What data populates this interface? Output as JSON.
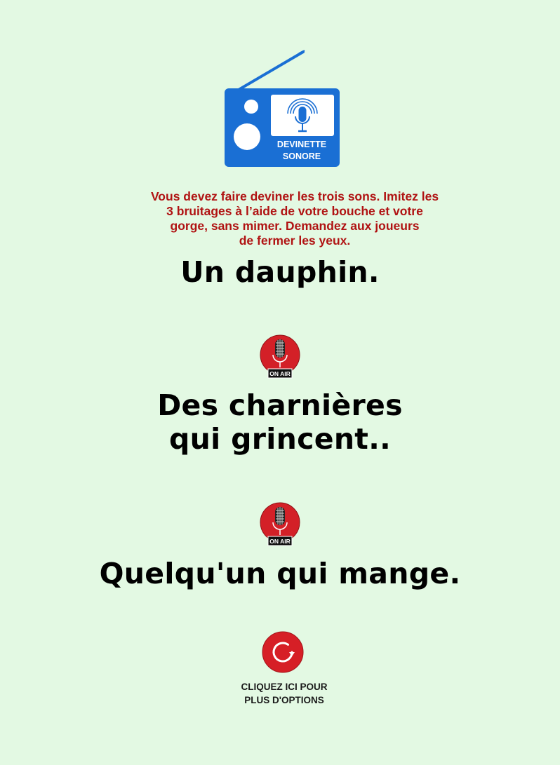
{
  "logo": {
    "icon": "radio-icon",
    "line1": "DEVINETTE",
    "line2": "SONORE",
    "colors": {
      "body": "#1a6fd4",
      "screen": "#ffffff",
      "label": "#ffffff"
    }
  },
  "instructions": {
    "lines": [
      "Vous devez faire deviner les trois sons. Imitez les",
      "3 bruitages à l’aide de votre bouche et votre",
      "gorge, sans mimer. Demandez aux joueurs",
      "de fermer les yeux."
    ],
    "color": "#b01313"
  },
  "sounds": [
    {
      "lines": [
        "Un dauphin."
      ]
    },
    {
      "lines": [
        "Des charnières",
        "qui grincent.."
      ]
    },
    {
      "lines": [
        "Quelqu'un qui mange."
      ]
    }
  ],
  "separator_icon": {
    "icon": "on-air-microphone-icon",
    "label": "ON AIR",
    "color": "#d32027"
  },
  "options_button": {
    "icon": "replay-icon",
    "lines": [
      "CLIQUEZ ICI POUR",
      "PLUS D'OPTIONS"
    ],
    "color": "#d61f26"
  }
}
